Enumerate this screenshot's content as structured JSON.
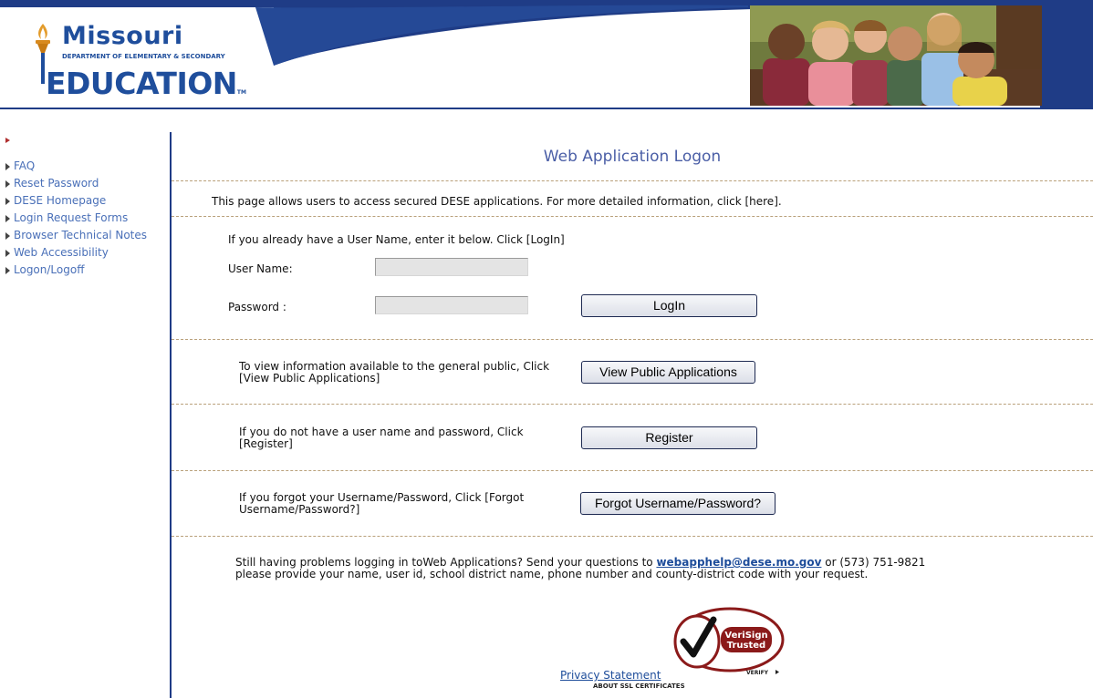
{
  "header": {
    "logo_missouri": "Missouri",
    "logo_department": "DEPARTMENT OF ELEMENTARY & SECONDARY",
    "logo_education": "EDUCATION",
    "logo_tm": "TM"
  },
  "sidebar": {
    "items": [
      {
        "label": "FAQ"
      },
      {
        "label": "Reset Password"
      },
      {
        "label": "DESE Homepage"
      },
      {
        "label": "Login Request Forms"
      },
      {
        "label": "Browser Technical Notes"
      },
      {
        "label": "Web Accessibility"
      },
      {
        "label": "Logon/Logoff"
      }
    ]
  },
  "main": {
    "title": "Web Application Logon",
    "intro": "This page allows users to access secured DESE applications.  For more detailed information, click [here].",
    "login": {
      "prompt": "If you already have a User Name, enter it below. Click [LogIn]",
      "username_label": "User Name:",
      "username_value": "",
      "password_label": "Password :",
      "password_value": "",
      "button_label": "LogIn"
    },
    "public": {
      "text_line1": "To view information available to the general public, Click",
      "text_line2": "[View Public Applications]",
      "button_label": "View Public Applications"
    },
    "register": {
      "text_line1": "If you do not have a user name and password, Click",
      "text_line2": "[Register]",
      "button_label": "Register"
    },
    "forgot": {
      "text_line1": "If you forgot your Username/Password, Click [Forgot",
      "text_line2": "Username/Password?]",
      "button_label": "Forgot Username/Password?"
    },
    "help": {
      "line1_before": "Still having problems logging in toWeb Applications? Send  your  questions  to  ",
      "email": "webapphelp@dese.mo.gov",
      "line1_after": "  or (573) 751-9821",
      "line2": "please provide  your  name, user id, school district name, phone number and county-district code with your request."
    },
    "verisign": {
      "line1": "VeriSign",
      "line2": "Trusted",
      "verify": "VERIFY"
    },
    "privacy_label": "Privacy Statement",
    "ssl_label": "ABOUT SSL CERTIFICATES"
  },
  "colors": {
    "brand_blue": "#1f4e9c",
    "banner_navy": "#1f3c86",
    "link_blue": "#4a70b8",
    "title_blue": "#4a5ea6",
    "dash_tan": "#b9a07a",
    "verisign_red": "#8b1a1a"
  }
}
